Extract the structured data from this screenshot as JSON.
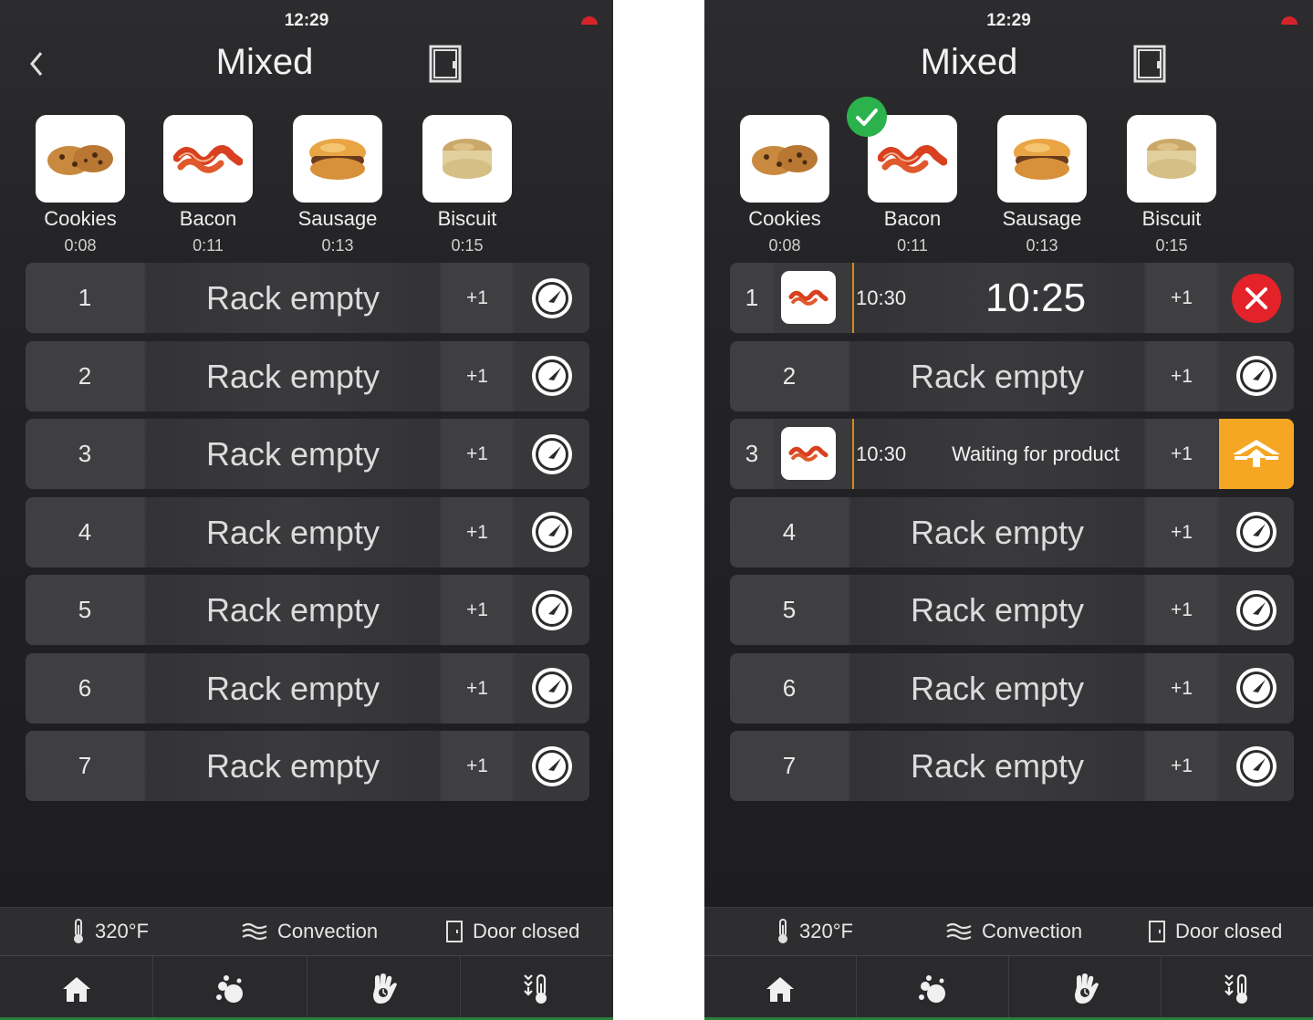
{
  "colors": {
    "accent_orange": "#f5a623",
    "cancel_red": "#e3222a",
    "check_green": "#2bb24c"
  },
  "screens": [
    {
      "clock": "12:29",
      "title": "Mixed",
      "products": [
        {
          "name": "Cookies",
          "time": "0:08",
          "icon": "cookie-image"
        },
        {
          "name": "Bacon",
          "time": "0:11",
          "icon": "bacon-image"
        },
        {
          "name": "Sausage",
          "time": "0:13",
          "icon": "sausage-image"
        },
        {
          "name": "Biscuit",
          "time": "0:15",
          "icon": "biscuit-image"
        }
      ],
      "racks": [
        {
          "num": "1",
          "label": "Rack empty",
          "plus": "+1"
        },
        {
          "num": "2",
          "label": "Rack empty",
          "plus": "+1"
        },
        {
          "num": "3",
          "label": "Rack empty",
          "plus": "+1"
        },
        {
          "num": "4",
          "label": "Rack empty",
          "plus": "+1"
        },
        {
          "num": "5",
          "label": "Rack empty",
          "plus": "+1"
        },
        {
          "num": "6",
          "label": "Rack empty",
          "plus": "+1"
        },
        {
          "num": "7",
          "label": "Rack empty",
          "plus": "+1"
        }
      ],
      "status": {
        "temp": "320°F",
        "mode": "Convection",
        "door": "Door closed"
      }
    },
    {
      "clock": "12:29",
      "title": "Mixed",
      "products": [
        {
          "name": "Cookies",
          "time": "0:08"
        },
        {
          "name": "Bacon",
          "time": "0:11"
        },
        {
          "name": "Sausage",
          "time": "0:13"
        },
        {
          "name": "Biscuit",
          "time": "0:15"
        }
      ],
      "racks": [
        {
          "num": "1",
          "set_time": "10:30",
          "remaining": "10:25",
          "plus": "+1",
          "product": "bacon"
        },
        {
          "num": "2",
          "label": "Rack empty",
          "plus": "+1"
        },
        {
          "num": "3",
          "set_time": "10:30",
          "message": "Waiting for product",
          "plus": "+1",
          "product": "bacon"
        },
        {
          "num": "4",
          "label": "Rack empty",
          "plus": "+1"
        },
        {
          "num": "5",
          "label": "Rack empty",
          "plus": "+1"
        },
        {
          "num": "6",
          "label": "Rack empty",
          "plus": "+1"
        },
        {
          "num": "7",
          "label": "Rack empty",
          "plus": "+1"
        }
      ],
      "status": {
        "temp": "320°F",
        "mode": "Convection",
        "door": "Door closed"
      }
    }
  ]
}
